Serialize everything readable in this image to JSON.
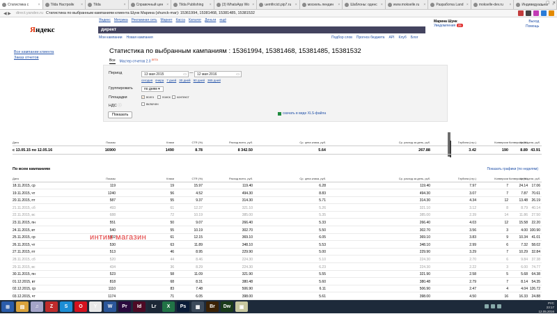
{
  "browser": {
    "tabs": [
      {
        "label": "Статистика с",
        "active": true
      },
      {
        "label": "Tilda Настройк",
        "active": false
      },
      {
        "label": "Tilda",
        "active": false
      },
      {
        "label": "Справочный цен",
        "active": false
      },
      {
        "label": "Tilda Publishing",
        "active": false
      },
      {
        "label": "(3) WhatsApp Wo",
        "active": false
      },
      {
        "label": "uemfircict.pip7.ru",
        "active": false
      },
      {
        "label": "москель лендин",
        "active": false
      },
      {
        "label": "Шаблоны: оденс",
        "active": false
      },
      {
        "label": "www.mokselle.ru",
        "active": false
      },
      {
        "label": "Разработка Land",
        "active": false
      },
      {
        "label": "mokselle-dev.ru",
        "active": false
      },
      {
        "label": "Индивидуальны",
        "active": false
      }
    ],
    "window_controls": [
      "_",
      "□",
      "×"
    ],
    "address": {
      "host": "direct.yandex.ru",
      "title": "Статистика по выбранным кампаниям клиента Шунк Марина (shunck-mar): 15361994, 15381468, 15381485, 15381532"
    },
    "ext_colors": [
      "#c23b3b",
      "#444444",
      "#c23bb5",
      "#2b7dd8",
      "#e38a00"
    ]
  },
  "header": {
    "logo_y": "Я",
    "logo_rest": "ндекс",
    "product": "директ",
    "top_nav": [
      "Яндекс",
      "Метрика",
      "Рекламная сеть",
      "Маркет",
      "Касса",
      "Каталог",
      "Деньги",
      "ещё"
    ],
    "sub_nav": [
      "Мои кампании",
      "Новая кампания"
    ],
    "right_nav": [
      "Подбор слов",
      "Прогноз бюджета",
      "API",
      "Клуб",
      "Блог"
    ],
    "user_name": "Марина Шунк",
    "notifications_label": "Уведомления",
    "notifications_count": "25",
    "user_links": [
      "Выход",
      "Помощь"
    ]
  },
  "sidebar": {
    "links": [
      "Все кампании клиента",
      "Заказ отчетов"
    ]
  },
  "main": {
    "title": "Статистика по выбранным кампаниям : 15361994, 15381468, 15381485, 15381532",
    "tabs": {
      "active": "Все",
      "master": "Мастер отчетов 2.0",
      "beta": "БЕТА"
    },
    "form": {
      "period_label": "Период",
      "date_from": "13 мая 2015",
      "date_to": "12 мая 2016",
      "quick_ranges": [
        "сегодня",
        "вчера",
        "7 дней",
        "30 дней",
        "90 дней",
        "365 дней"
      ],
      "group_label": "Группировать",
      "group_value": "по дням",
      "placements_label": "Площадки",
      "placements": [
        {
          "label": "всего",
          "checked": true
        },
        {
          "label": "поиск",
          "checked": false
        },
        {
          "label": "контекст",
          "checked": false
        }
      ],
      "vat_label": "НДС",
      "vat_option": "включен",
      "show_button": "Показать",
      "xls_link": "скачать в виде XLS-файла"
    },
    "summary": {
      "headers": [
        "Дата",
        "Показы",
        "Клики",
        "CTR (%)",
        "Расход всего, руб.",
        "Ср. цена клика, руб.",
        "Ср. расход за день, руб.",
        "Глубина (стр.)",
        "Конверсии",
        "Конверсия (%)",
        "Цена цели, руб."
      ],
      "total": [
        "с 13.05.15 по 12.05.16",
        "16900",
        "1490",
        "8.78",
        "8 342.50",
        "5.64",
        "267.88",
        "3.42",
        "190",
        "8.89",
        "43.91"
      ]
    },
    "section_title": "По всем кампаниям",
    "graph_link": "Показать графики (по неделям)",
    "rows": [
      {
        "date": "18.11.2015, ср",
        "imp": "119",
        "clk": "19",
        "ctr": "15.97",
        "cost": "119.40",
        "cpc": "6.28",
        "daily": "119.40",
        "depth": "7.97",
        "conv": "7",
        "convr": "24.14",
        "cpa": "17.06",
        "dim": false
      },
      {
        "date": "19.11.2015, чт",
        "imp": "1240",
        "clk": "56",
        "ctr": "4.52",
        "cost": "494.30",
        "cpc": "8.83",
        "daily": "494.30",
        "depth": "3.07",
        "conv": "7",
        "convr": "7.87",
        "cpa": "70.61",
        "dim": false
      },
      {
        "date": "20.11.2015, пт",
        "imp": "587",
        "clk": "55",
        "ctr": "9.37",
        "cost": "314.30",
        "cpc": "5.71",
        "daily": "314.30",
        "depth": "4.34",
        "conv": "12",
        "convr": "13.48",
        "cpa": "26.19",
        "dim": false
      },
      {
        "date": "21.11.2015, сб",
        "imp": "493",
        "clk": "61",
        "ctr": "12.37",
        "cost": "321.10",
        "cpc": "5.26",
        "daily": "321.10",
        "depth": "3.12",
        "conv": "8",
        "convr": "8.79",
        "cpa": "40.14",
        "dim": true
      },
      {
        "date": "22.11.2015, вс",
        "imp": "688",
        "clk": "72",
        "ctr": "10.19",
        "cost": "385.00",
        "cpc": "5.35",
        "daily": "385.00",
        "depth": "2.39",
        "conv": "14",
        "convr": "11.86",
        "cpa": "27.50",
        "dim": true
      },
      {
        "date": "23.11.2015, пн",
        "imp": "551",
        "clk": "50",
        "ctr": "9.07",
        "cost": "266.40",
        "cpc": "5.33",
        "daily": "266.40",
        "depth": "4.03",
        "conv": "12",
        "convr": "15.58",
        "cpa": "22.20",
        "dim": false
      },
      {
        "date": "24.11.2015, вт",
        "imp": "540",
        "clk": "55",
        "ctr": "10.19",
        "cost": "302.70",
        "cpc": "5.50",
        "daily": "302.70",
        "depth": "3.56",
        "conv": "3",
        "convr": "4.00",
        "cpa": "100.90",
        "dim": false
      },
      {
        "date": "25.11.2015, ср",
        "imp": "502",
        "clk": "61",
        "ctr": "12.15",
        "cost": "369.10",
        "cpc": "6.05",
        "daily": "369.10",
        "depth": "3.83",
        "conv": "9",
        "convr": "10.34",
        "cpa": "41.01",
        "dim": false
      },
      {
        "date": "26.11.2015, чт",
        "imp": "530",
        "clk": "63",
        "ctr": "11.89",
        "cost": "348.10",
        "cpc": "5.53",
        "daily": "348.10",
        "depth": "2.99",
        "conv": "6",
        "convr": "7.32",
        "cpa": "58.02",
        "dim": false
      },
      {
        "date": "27.11.2015, пт",
        "imp": "513",
        "clk": "46",
        "ctr": "8.95",
        "cost": "229.90",
        "cpc": "5.00",
        "daily": "229.90",
        "depth": "3.29",
        "conv": "7",
        "convr": "10.29",
        "cpa": "32.84",
        "dim": false
      },
      {
        "date": "28.11.2015, сб",
        "imp": "520",
        "clk": "44",
        "ctr": "8.46",
        "cost": "224.30",
        "cpc": "5.10",
        "daily": "224.30",
        "depth": "2.70",
        "conv": "6",
        "convr": "9.84",
        "cpa": "37.38",
        "dim": true
      },
      {
        "date": "29.11.2015, вс",
        "imp": "434",
        "clk": "36",
        "ctr": "8.29",
        "cost": "224.30",
        "cpc": "6.23",
        "daily": "224.30",
        "depth": "2.22",
        "conv": "3",
        "convr": "6.00",
        "cpa": "74.77",
        "dim": true
      },
      {
        "date": "30.11.2015, пн",
        "imp": "523",
        "clk": "58",
        "ctr": "11.09",
        "cost": "321.90",
        "cpc": "5.55",
        "daily": "321.90",
        "depth": "2.58",
        "conv": "5",
        "convr": "5.68",
        "cpa": "64.38",
        "dim": false
      },
      {
        "date": "01.12.2015, вт",
        "imp": "818",
        "clk": "68",
        "ctr": "8.31",
        "cost": "380.48",
        "cpc": "5.60",
        "daily": "380.48",
        "depth": "2.79",
        "conv": "7",
        "convr": "8.14",
        "cpa": "54.35",
        "dim": false
      },
      {
        "date": "02.12.2015, ср",
        "imp": "1110",
        "clk": "83",
        "ctr": "7.48",
        "cost": "506.90",
        "cpc": "6.11",
        "daily": "506.90",
        "depth": "2.47",
        "conv": "4",
        "convr": "4.04",
        "cpa": "126.72",
        "dim": false
      },
      {
        "date": "03.12.2015, чт",
        "imp": "1174",
        "clk": "71",
        "ctr": "6.05",
        "cost": "398.00",
        "cpc": "5.61",
        "daily": "398.00",
        "depth": "4.50",
        "conv": "16",
        "convr": "16.33",
        "cpa": "24.88",
        "dim": false
      }
    ]
  },
  "overlay_text": "интим магазин",
  "taskbar": {
    "apps": [
      {
        "icon": "windows-icon",
        "glyph": "⊞",
        "color": "#2a5caa"
      },
      {
        "icon": "explorer-icon",
        "glyph": "▤",
        "color": "#d9a23b"
      },
      {
        "icon": "itunes-icon",
        "glyph": "♫",
        "color": "#a4a4c8"
      },
      {
        "icon": "filezilla-icon",
        "glyph": "Z",
        "color": "#bf2b2b"
      },
      {
        "icon": "skype-icon",
        "glyph": "S",
        "color": "#1c8dd4"
      },
      {
        "icon": "opera-icon",
        "glyph": "O",
        "color": "#d4121e"
      },
      {
        "icon": "yandex-browser-icon",
        "glyph": "Y",
        "color": "#e8e8e8"
      },
      {
        "icon": "word-icon",
        "glyph": "W",
        "color": "#2b579a"
      },
      {
        "icon": "premiere-icon",
        "glyph": "Pr",
        "color": "#2a0a3e"
      },
      {
        "icon": "indesign-icon",
        "glyph": "Id",
        "color": "#4d0a25"
      },
      {
        "icon": "lightroom-icon",
        "glyph": "Lr",
        "color": "#1b2735"
      },
      {
        "icon": "excel-icon",
        "glyph": "X",
        "color": "#217346"
      },
      {
        "icon": "photoshop-icon",
        "glyph": "Ps",
        "color": "#0a1c38"
      },
      {
        "icon": "folder-icon",
        "glyph": "▦",
        "color": "#3c4a5a"
      },
      {
        "icon": "bridge-icon",
        "glyph": "Br",
        "color": "#3b2206"
      },
      {
        "icon": "dreamweaver-icon",
        "glyph": "Dw",
        "color": "#1a3b1a"
      },
      {
        "icon": "notes-icon",
        "glyph": "▣",
        "color": "#c8c8a0"
      }
    ],
    "lang": "РУС",
    "time": "23:17",
    "date": "12.05.2016"
  }
}
